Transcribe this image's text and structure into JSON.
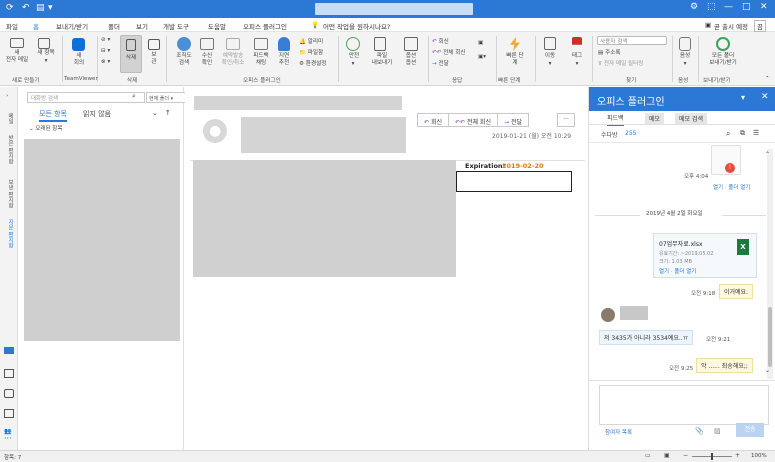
{
  "titlebar": {
    "controls": [
      "⚙",
      "⬚",
      "—",
      "□",
      "✕"
    ]
  },
  "menu": {
    "items": [
      "파일",
      "홈",
      "보내기/받기",
      "폴더",
      "보기",
      "개발 도구",
      "도움말",
      "오피스 플러그인"
    ],
    "tell_me": "어떤 작업을 원하시나요?",
    "trial": "곧 출시 예정",
    "trial_toggle": "끔"
  },
  "ribbon": {
    "new_email": "새\n전자 메일",
    "new_items": "새 항목",
    "new_meeting": "새\n회의",
    "delete": "삭제",
    "archive": "보\n관",
    "reply": "회신",
    "reply_all": "전체 회신",
    "forward": "전달",
    "quick_steps": "빠른 단\n계",
    "move": "이동",
    "tags": "태그",
    "search_people": "사용자 검색",
    "address_book": "주소록",
    "filter_email": "전자 메일 필터링",
    "voice": "음성",
    "send_receive_all": "모든 폴더\n보내기/받기",
    "org_search": "조직도\n검색",
    "receive_confirm": "수신\n확인",
    "reserve_send": "예약발송\n확인/취소",
    "feedback_chat": "피드백\n채팅",
    "policy_recommend": "지연\n추천",
    "notify": "알리미",
    "file_share": "파일함",
    "env_setting": "환경설정",
    "safe": "안전",
    "file_send": "파일\n내보내기",
    "option": "옵션\n옵션",
    "groups": {
      "new": "새로 만들기",
      "teamviewer": "TeamViewer",
      "delete": "삭제",
      "plugin": "오피스 플러그인",
      "respond": "응답",
      "quick": "빠른 단계",
      "find": "찾기",
      "voice": "음성",
      "send_receive": "보내기/받기"
    }
  },
  "nav": {
    "labels": [
      "메일",
      "받은 편지함",
      "보낸 편지함",
      "지운 편지함"
    ]
  },
  "msglist": {
    "search_placeholder": "대화방 검색",
    "scope": "현재 폴더",
    "tab_all": "모든 항목",
    "tab_unread": "읽지 않음",
    "group_header": "오래된 항목"
  },
  "reading": {
    "reply": "회신",
    "reply_all": "전체 회신",
    "forward": "전달",
    "more": "···",
    "date": "2019-01-21 (월) 오전 10:29",
    "expiration_label": "Expiration:",
    "expiration_date": "2019-02-20"
  },
  "panel": {
    "title": "오피스 플러그인",
    "tabs": [
      "피드백",
      "메모",
      "메모 검색"
    ],
    "counter_label": "수다방",
    "counter_value": "255",
    "msg_time_1": "오후 4:04",
    "open_links": "열기 · 폴더 열기",
    "date_divider": "2019년 4월 2일 화요일",
    "attachment_name": "07업무자료.xlsx",
    "attachment_exp": "유효기간: ~2019.05.02",
    "attachment_size": "크기: 1.03 MB",
    "attachment_links": "열기 · 폴더 열기",
    "time_2": "오전 9:18",
    "bubble_2": "이거예요.",
    "bubble_3": "저 3435가 아니라 3534예요..ㅠ",
    "time_3": "오전 9:21",
    "time_4": "오전 9:25",
    "bubble_4": "악 ...... 죄송해요;;",
    "participants": "참여자 목록",
    "send": "전송"
  },
  "status": {
    "items": "항목: 7",
    "zoom": "100%"
  },
  "colors": {
    "accent": "#2b79d5",
    "orange": "#e07b00"
  }
}
